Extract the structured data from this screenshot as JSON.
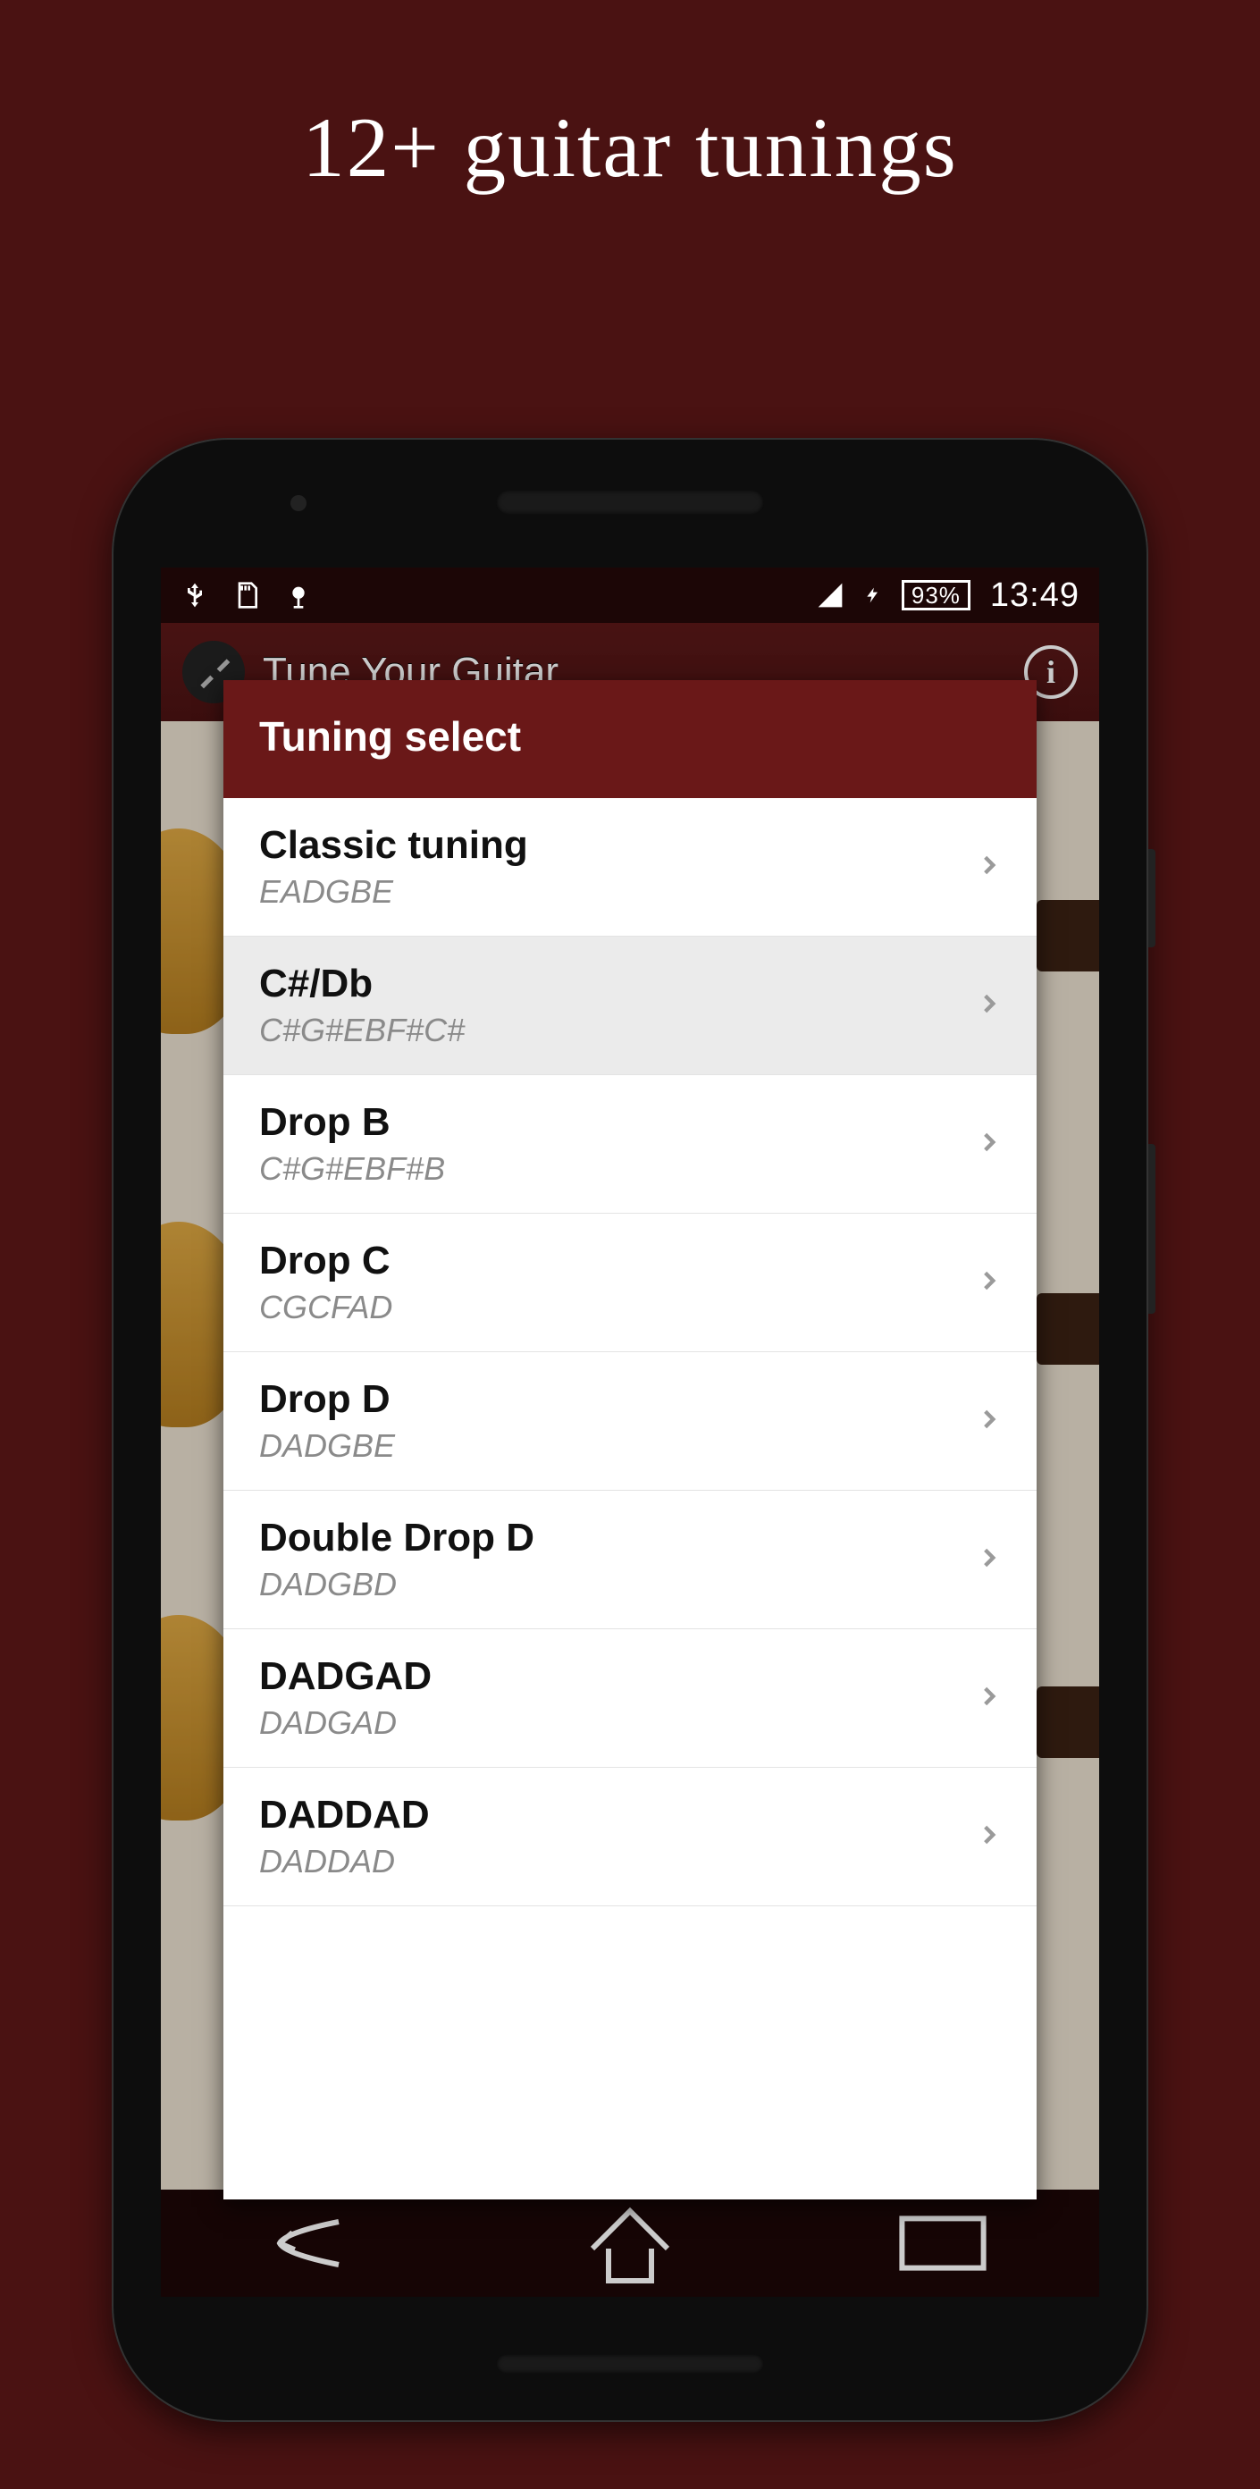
{
  "promo": {
    "title": "12+ guitar tunings"
  },
  "status_bar": {
    "battery_pct": "93%",
    "time": "13:49"
  },
  "app": {
    "title": "Tune Your Guitar"
  },
  "dialog": {
    "title": "Tuning select",
    "items": [
      {
        "name": "Classic tuning",
        "notes": "EADGBE",
        "selected": false
      },
      {
        "name": "C#/Db",
        "notes": "C#G#EBF#C#",
        "selected": true
      },
      {
        "name": "Drop B",
        "notes": "C#G#EBF#B",
        "selected": false
      },
      {
        "name": "Drop C",
        "notes": "CGCFAD",
        "selected": false
      },
      {
        "name": "Drop D",
        "notes": "DADGBE",
        "selected": false
      },
      {
        "name": "Double Drop D",
        "notes": "DADGBD",
        "selected": false
      },
      {
        "name": "DADGAD",
        "notes": "DADGAD",
        "selected": false
      },
      {
        "name": "DADDAD",
        "notes": "DADDAD",
        "selected": false
      }
    ]
  }
}
